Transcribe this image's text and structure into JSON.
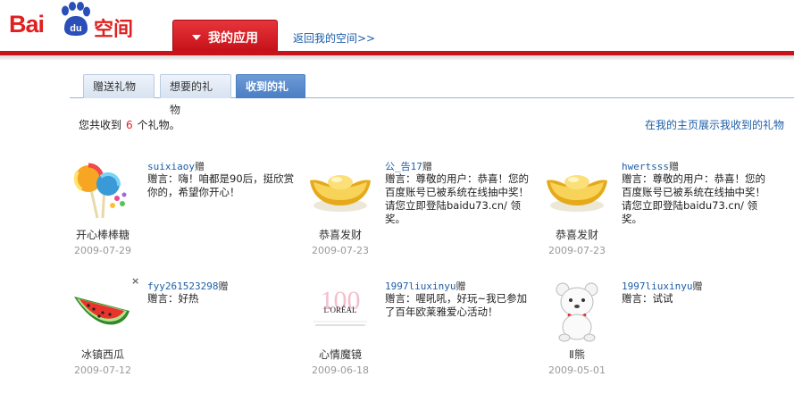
{
  "header": {
    "logo_text": "Bai",
    "logo_du": "du",
    "logo_space": "空间",
    "app_tab_label": "我的应用",
    "back_link": "返回我的空间>>"
  },
  "tabs": [
    {
      "label": "赠送礼物",
      "active": false
    },
    {
      "label": "想要的礼物",
      "active": false
    },
    {
      "label": "收到的礼物",
      "active": true
    }
  ],
  "summary": {
    "prefix": "您共收到",
    "count": "6",
    "suffix": "个礼物。",
    "show_link": "在我的主页展示我收到的礼物"
  },
  "gifts": [
    {
      "name": "开心棒棒糖",
      "date": "2009-07-29",
      "sender": "suixiaoy",
      "gives": "赠",
      "msg_label": "赠言：",
      "msg": "嗨！咱都是90后，挺欣赏你的，希望你开心！",
      "icon": "lollipop-icon"
    },
    {
      "name": "恭喜发财",
      "date": "2009-07-23",
      "sender": "公_告17",
      "gives": "赠",
      "msg_label": "赠言：",
      "msg": "尊敬的用户：恭喜！您的百度账号已被系统在线抽中奖！请您立即登陆baidu73.cn/ 领奖。",
      "icon": "gold-ingot-icon"
    },
    {
      "name": "恭喜发财",
      "date": "2009-07-23",
      "sender": "hwertsss",
      "gives": "赠",
      "msg_label": "赠言：",
      "msg": "尊敬的用户：恭喜！您的百度账号已被系统在线抽中奖！请您立即登陆baidu73.cn/ 领奖。",
      "icon": "gold-ingot-icon"
    },
    {
      "name": "冰镇西瓜",
      "date": "2009-07-12",
      "sender": "fyy261523298",
      "gives": "赠",
      "msg_label": "赠言：",
      "msg": "好热",
      "icon": "watermelon-icon",
      "close": "×"
    },
    {
      "name": "心情魔镜",
      "date": "2009-06-18",
      "sender": "1997liuxinyu",
      "gives": "赠",
      "msg_label": "赠言：",
      "msg": "喔吼吼，好玩~我已参加了百年欧莱雅爱心活动！",
      "icon": "loreal-100-icon",
      "logo_text": "L'ORÉAL"
    },
    {
      "name": "Ⅱ熊",
      "date": "2009-05-01",
      "sender": "1997liuxinyu",
      "gives": "赠",
      "msg_label": "赠言：",
      "msg": "试试",
      "icon": "white-bear-icon"
    }
  ]
}
